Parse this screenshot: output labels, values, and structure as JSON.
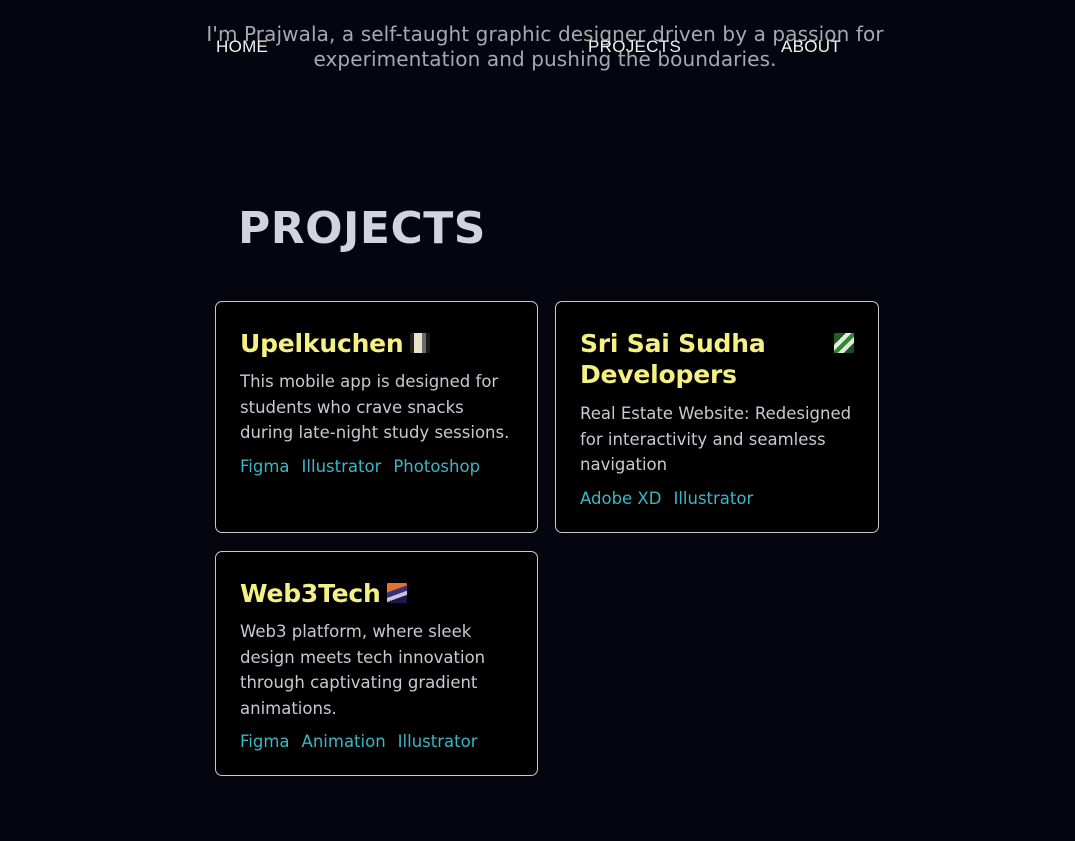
{
  "intro": {
    "text": "I'm Prajwala, a self-taught graphic designer driven by a passion for experimentation and pushing the boundaries."
  },
  "nav": {
    "home": "HOME",
    "projects": "PROJECTS",
    "about": "ABOUT"
  },
  "section": {
    "title": "PROJECTS"
  },
  "projects": [
    {
      "title": "Upelkuchen",
      "thumb_icon": "app-thumbnail-icon",
      "description": "This mobile app is designed for students who crave snacks during late-night study sessions.",
      "tags": [
        "Figma",
        "Illustrator",
        "Photoshop"
      ]
    },
    {
      "title": "Sri Sai Sudha Developers",
      "thumb_icon": "building-thumbnail-icon",
      "description": "Real Estate Website: Redesigned for interactivity and seamless navigation",
      "tags": [
        "Adobe XD",
        "Illustrator"
      ]
    },
    {
      "title": "Web3Tech",
      "thumb_icon": "web3-thumbnail-icon",
      "description": "Web3 platform, where sleek design meets tech innovation through captivating gradient animations.",
      "tags": [
        "Figma",
        "Animation",
        "Illustrator"
      ]
    }
  ],
  "colors": {
    "background": "#05050f",
    "card_title": "#f5f083",
    "tag": "#3bb6c4",
    "card_border": "#c9c9d1"
  }
}
